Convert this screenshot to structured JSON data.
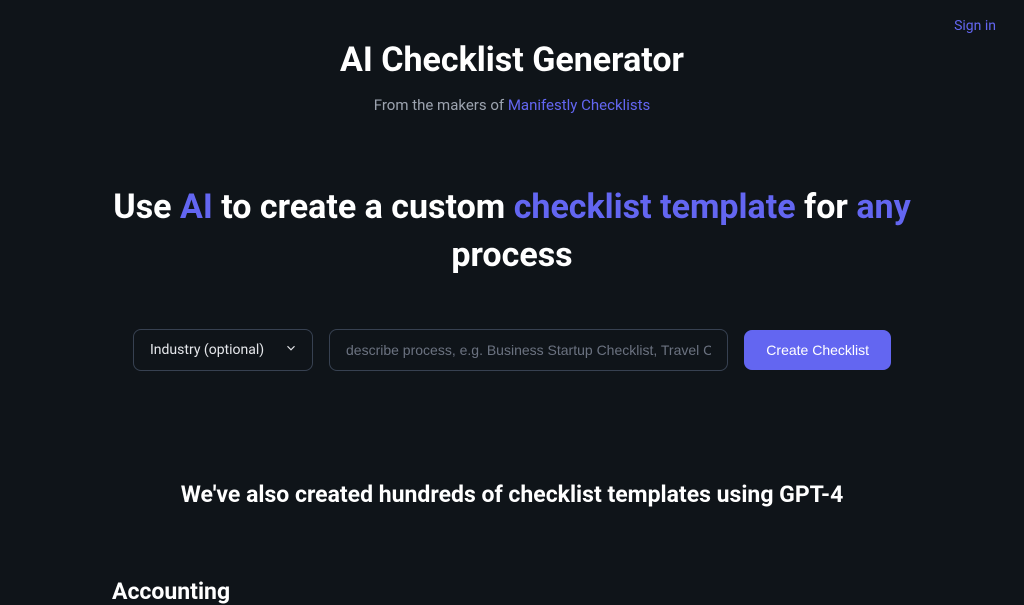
{
  "nav": {
    "sign_in": "Sign in"
  },
  "header": {
    "title": "AI Checklist Generator",
    "subtitle_prefix": "From the makers of ",
    "subtitle_link": "Manifestly Checklists"
  },
  "hero": {
    "part1": "Use ",
    "highlight1": "AI",
    "part2": " to create a custom ",
    "highlight2": "checklist template",
    "part3": " for ",
    "highlight3": "any",
    "part4": " process"
  },
  "form": {
    "dropdown_label": "Industry (optional)",
    "input_placeholder": "describe process, e.g. Business Startup Checklist, Travel Checklist, e",
    "button_label": "Create Checklist"
  },
  "section": {
    "heading": "We've also created hundreds of checklist templates using GPT-4"
  },
  "categories": {
    "first": "Accounting"
  }
}
